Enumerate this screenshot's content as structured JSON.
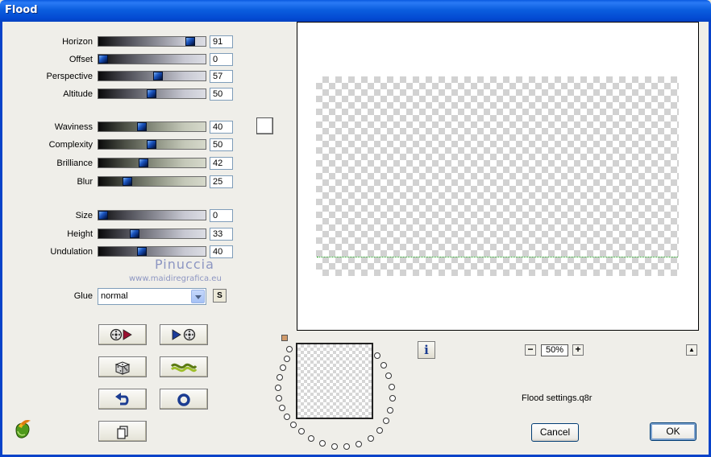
{
  "window": {
    "title": "Flood"
  },
  "sliders": [
    {
      "id": "horizon",
      "label": "Horizon",
      "value": "91",
      "fraction": 0.91,
      "track": "grey"
    },
    {
      "id": "offset",
      "label": "Offset",
      "value": "0",
      "fraction": 0.0,
      "track": "grey"
    },
    {
      "id": "perspective",
      "label": "Perspective",
      "value": "57",
      "fraction": 0.57,
      "track": "grey"
    },
    {
      "id": "altitude",
      "label": "Altitude",
      "value": "50",
      "fraction": 0.5,
      "track": "grey"
    },
    {
      "id": "waviness",
      "label": "Waviness",
      "value": "40",
      "fraction": 0.4,
      "track": "olive"
    },
    {
      "id": "complexity",
      "label": "Complexity",
      "value": "50",
      "fraction": 0.5,
      "track": "olive"
    },
    {
      "id": "brilliance",
      "label": "Brilliance",
      "value": "42",
      "fraction": 0.42,
      "track": "olive"
    },
    {
      "id": "blur",
      "label": "Blur",
      "value": "25",
      "fraction": 0.25,
      "track": "olive"
    },
    {
      "id": "size",
      "label": "Size",
      "value": "0",
      "fraction": 0.0,
      "track": "grey"
    },
    {
      "id": "height",
      "label": "Height",
      "value": "33",
      "fraction": 0.33,
      "track": "grey"
    },
    {
      "id": "undulation",
      "label": "Undulation",
      "value": "40",
      "fraction": 0.4,
      "track": "grey"
    }
  ],
  "watermark": {
    "name": "Pinuccia",
    "url": "www.maidiregrafica.eu"
  },
  "glue": {
    "label": "Glue",
    "value": "normal",
    "s_label": "S"
  },
  "zoom": {
    "value": "50%",
    "minus": "−",
    "plus": "+"
  },
  "info_label": "i",
  "settings_file": "Flood settings.q8r",
  "buttons": {
    "cancel": "Cancel",
    "ok": "OK"
  },
  "colors": {
    "titlebar": "#0a5ae0",
    "thumb": "#1c56c0",
    "flood_line": "#1aa51a",
    "nav_marker": "#d09a6a"
  }
}
